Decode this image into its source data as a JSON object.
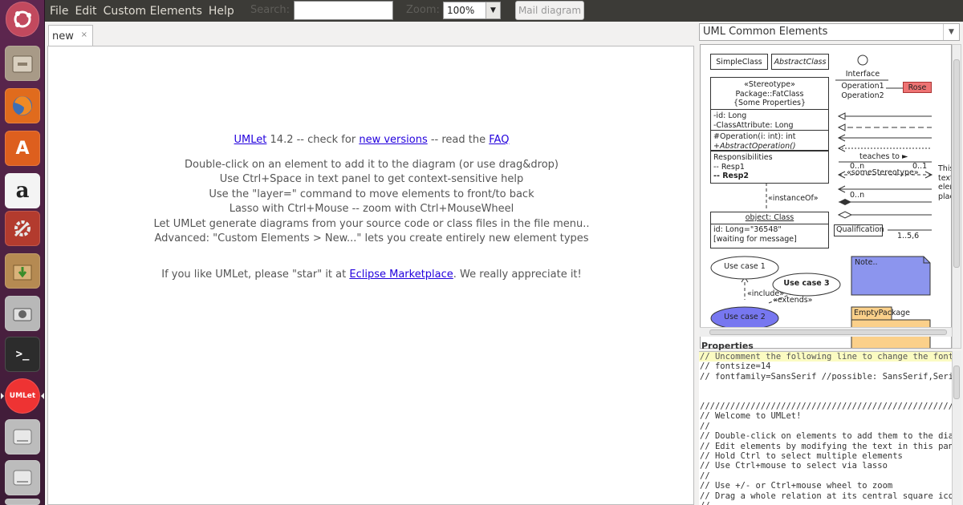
{
  "menubar": {
    "items": [
      "File",
      "Edit",
      "Custom Elements",
      "Help"
    ],
    "search_label": "Search:",
    "search_value": "",
    "zoom_label": "Zoom:",
    "zoom_value": "100%",
    "mail_button": "Mail diagram"
  },
  "diagram": {
    "tab_label": "new",
    "tab_close": "×",
    "welcome": {
      "line1_link": "UMLet",
      "line1_mid": " 14.2 -- check for ",
      "line1_link2": "new versions",
      "line1_mid2": " -- read the ",
      "line1_link3": "FAQ",
      "lines": [
        "Double-click on an element to add it to the diagram (or use drag&drop)",
        "Use Ctrl+Space in text panel to get context-sensitive help",
        "Use the \"layer=\" command to move elements to front/to back",
        "Lasso with Ctrl+Mouse -- zoom with Ctrl+MouseWheel",
        "Let UMLet generate diagrams from your source code or class files in the file menu..",
        "Advanced: \"Custom Elements > New...\" lets you create entirely new element types"
      ],
      "star_pre": "If you like UMLet, please \"star\" it at ",
      "star_link": "Eclipse Marketplace",
      "star_post": ". We really appreciate it!"
    }
  },
  "palette": {
    "selected": "UML Common Elements",
    "simple_class": "SimpleClass",
    "abstract_class": "AbstractClass",
    "interface_label": "Interface",
    "interface_ops": [
      "Operation1",
      "Operation2"
    ],
    "rose": "Rose",
    "fat_class": {
      "header": [
        "«Stereotype»",
        "Package::FatClass",
        "{Some Properties}"
      ],
      "attrs": [
        "-id: Long",
        "-ClassAttribute: Long"
      ],
      "ops": [
        "#Operation(i: int): int",
        "+AbstractOperation()"
      ],
      "resp": [
        "Responsibilities",
        "-- Resp1",
        "-- Resp2"
      ]
    },
    "instance_of": "«instanceOf»",
    "object": {
      "title": "object: Class",
      "lines": [
        "id: Long=\"36548\"",
        "[waiting for message]"
      ]
    },
    "teaches": "teaches to ►",
    "mult1": "0..n",
    "mult2": "0..1",
    "some_stereo": "«someStereotype»",
    "mult3": "0..n",
    "side_text": [
      "This",
      "text",
      "elem",
      "plac"
    ],
    "qualification": "Qualification",
    "mult4": "1..5,6",
    "use_case1": "Use case 1",
    "use_case3": "Use case 3",
    "include": "«include»",
    "extends": "«extends»",
    "use_case2": "Use case 2",
    "note": "Note..",
    "empty_package": "EmptyPackage"
  },
  "properties": {
    "title": "Properties",
    "lines": [
      "// Uncomment the following line to change the fontsize",
      "// fontsize=14",
      "// fontfamily=SansSerif //possible: SansSerif,Serif,Monospaced",
      "",
      "",
      "//////////////////////////////////////////////////////////////////////",
      "// Welcome to UMLet!",
      "//",
      "// Double-click on elements to add them to the diagram, or to copy them",
      "// Edit elements by modifying the text in this panel",
      "// Hold Ctrl to select multiple elements",
      "// Use Ctrl+mouse to select via lasso",
      "//",
      "// Use +/- or Ctrl+mouse wheel to zoom",
      "// Drag a whole relation at its central square icon",
      "//"
    ]
  },
  "launcher": {
    "items": [
      "ubuntu-dash",
      "files",
      "firefox",
      "software-center",
      "amazon",
      "system-settings",
      "archive-manager",
      "camera",
      "terminal",
      "umlet",
      "drive-1",
      "drive-2",
      "drive-3"
    ],
    "umlet_label": "UMLet"
  }
}
